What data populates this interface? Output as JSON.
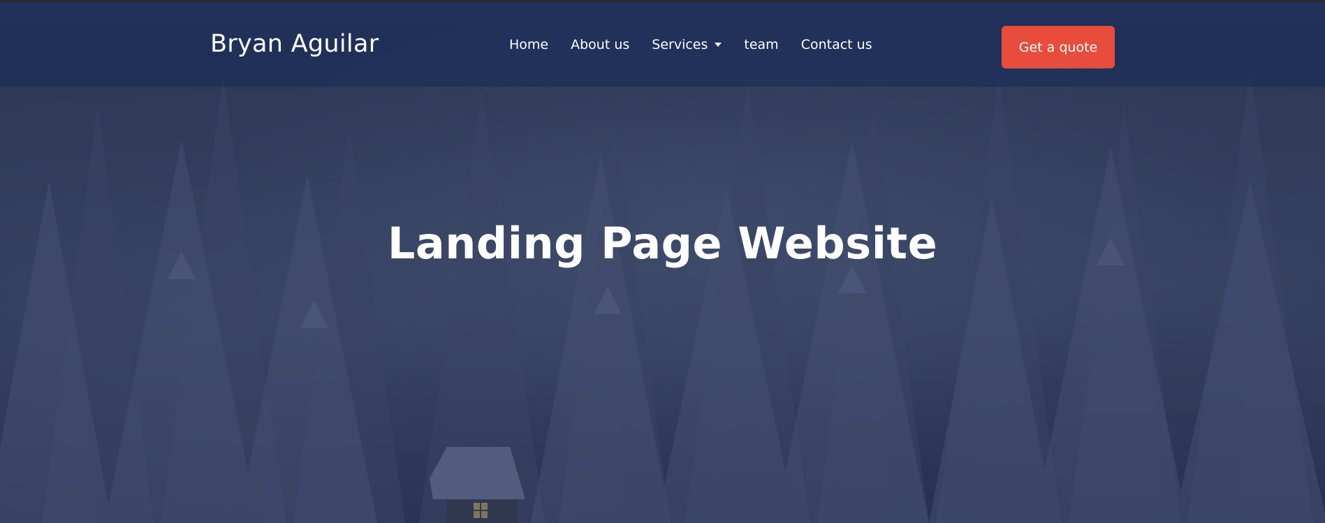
{
  "navbar": {
    "brand": "Bryan Aguilar",
    "links": [
      {
        "label": "Home"
      },
      {
        "label": "About us"
      },
      {
        "label": "Services",
        "has_dropdown": true
      },
      {
        "label": "team"
      },
      {
        "label": "Contact us"
      }
    ],
    "cta_label": "Get a quote"
  },
  "hero": {
    "title": "Landing Page Website"
  },
  "colors": {
    "navbar_bg": "#1f3366",
    "cta_bg": "#e74c3c",
    "text": "#ffffff"
  },
  "icons": {
    "services_dropdown": "caret-down-icon"
  }
}
